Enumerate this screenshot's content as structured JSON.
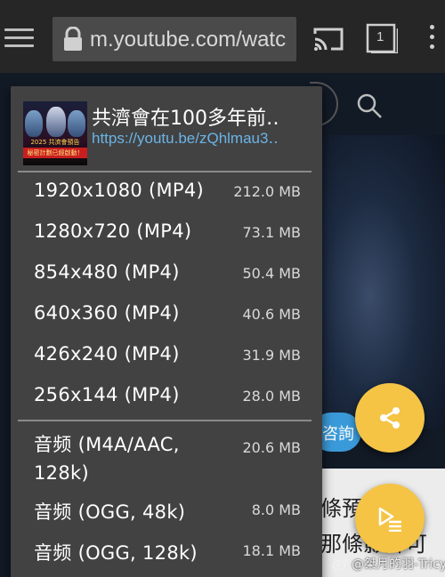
{
  "browser": {
    "url": "m.youtube.com/watc",
    "tab_count": "1"
  },
  "background": {
    "chip_text": "咨詢",
    "line1": "條預告 其",
    "line2": "那條影片可"
  },
  "popup": {
    "video_title": "共濟會在100多年前‥",
    "video_link": "https://youtu.be/zQhlmau3‥",
    "thumbnail_caption": "2025 共濟會預告",
    "thumbnail_caption2": "秘密計劃已經啟動！",
    "video_options": [
      {
        "label": "1920x1080  (MP4)",
        "size": "212.0  MB"
      },
      {
        "label": "1280x720  (MP4)",
        "size": "73.1  MB"
      },
      {
        "label": "854x480  (MP4)",
        "size": "50.4  MB"
      },
      {
        "label": "640x360  (MP4)",
        "size": "40.6  MB"
      },
      {
        "label": "426x240  (MP4)",
        "size": "31.9  MB"
      },
      {
        "label": "256x144  (MP4)",
        "size": "28.0  MB"
      }
    ],
    "audio_options": [
      {
        "label": "音频  (M4A/AAC, 128k)",
        "size": "20.6  MB"
      },
      {
        "label": "音频  (OGG,  48k)",
        "size": "8.0  MB"
      },
      {
        "label": "音频  (OGG,  128k)",
        "size": "18.1  MB"
      }
    ]
  },
  "colors": {
    "fab": "#f5c445",
    "link": "#6ab4e8",
    "menu_bg": "#424242"
  },
  "icons": [
    "menu-icon",
    "lock-icon",
    "cast-icon",
    "tabs-icon",
    "more-icon",
    "search-icon",
    "share-icon",
    "play-queue-icon",
    "weibo-icon"
  ],
  "watermark": "@桀月的羽-Tricy"
}
